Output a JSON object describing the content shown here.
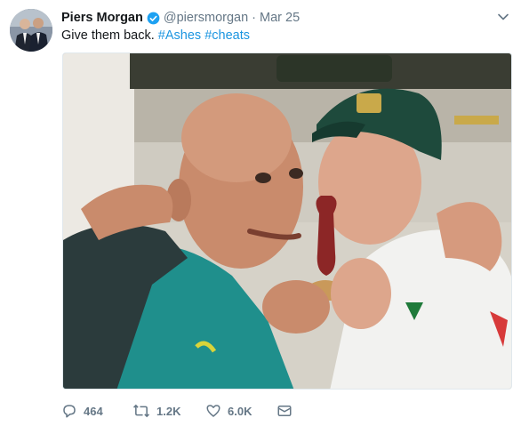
{
  "tweet": {
    "author_name": "Piers Morgan",
    "author_handle": "@piersmorgan",
    "separator": "·",
    "date": "Mar 25",
    "text_plain": "Give them back.",
    "hashtags": [
      "#Ashes",
      "#cheats"
    ],
    "avatar_icon": "avatar-photo",
    "verified_icon": "verified-badge-icon",
    "verified_color": "#1da1f2",
    "hashtag_color": "#1b95e0"
  },
  "photo": {
    "label": "photo"
  },
  "actions": {
    "reply": {
      "icon": "reply-icon",
      "count": "464"
    },
    "retweet": {
      "icon": "retweet-icon",
      "count": "1.2K"
    },
    "like": {
      "icon": "heart-icon",
      "count": "6.0K"
    },
    "message": {
      "icon": "envelope-icon"
    }
  },
  "colors": {
    "muted": "#657786",
    "text": "#14171a"
  }
}
